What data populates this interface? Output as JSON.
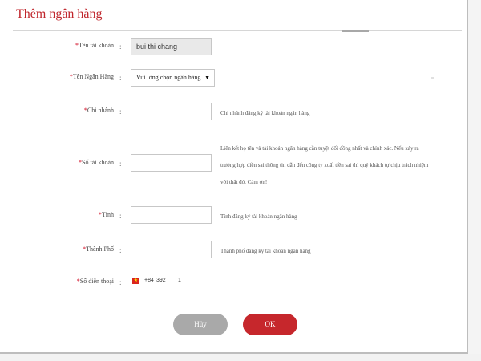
{
  "dialog": {
    "title": "Thêm ngân hàng"
  },
  "fields": {
    "account_name": {
      "label": "Tên tài khoản",
      "value": "bui thi chang"
    },
    "bank_name": {
      "label": "Tên Ngân Hàng",
      "selected": "Vui lòng chọn ngân hàng"
    },
    "branch": {
      "label": "Chi nhánh",
      "value": "",
      "help": "Chi nhánh đăng ký tài khoản ngân hàng"
    },
    "account_number": {
      "label": "Số tài khoản",
      "value": "",
      "help": "Liên kết họ tên và tài khoản ngân hàng cần tuyệt đối đồng nhất và chính xác. Nếu xảy ra trường hợp điền sai thông tin dẫn đến công ty xuất tiền sai thì quý khách tự chịu trách nhiệm với thất đó. Cảm ơn!"
    },
    "province": {
      "label": "Tỉnh",
      "value": "",
      "help": "Tỉnh đăng ký tài khoản ngân hàng"
    },
    "city": {
      "label": "Thành Phố",
      "value": "",
      "help": "Thành phố đăng ký tài khoản ngân hàng"
    },
    "phone": {
      "label": "Số điện thoại",
      "country_code": "+84",
      "number": "392",
      "suffix": "1"
    }
  },
  "buttons": {
    "cancel": "Hủy",
    "ok": "OK"
  },
  "colors": {
    "accent": "#c6272c",
    "title": "#c0272d",
    "cancel": "#a9a9a9",
    "required_star": "#d0021b"
  },
  "icons": {
    "flag": "vietnam-flag-icon",
    "dropdown": "chevron-down-icon"
  }
}
